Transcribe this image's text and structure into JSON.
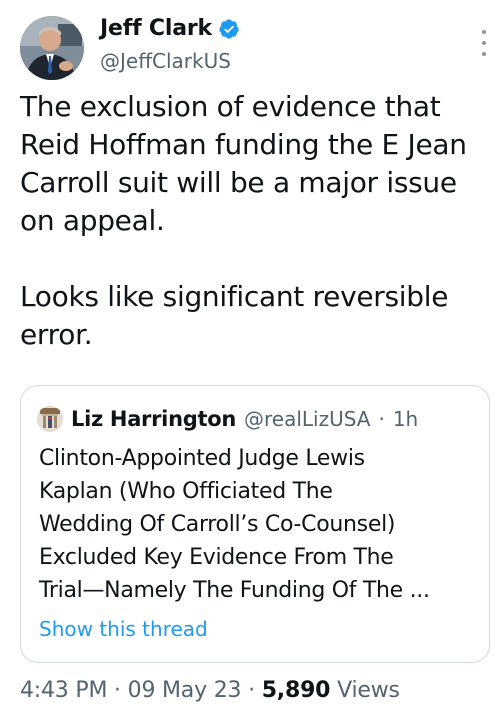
{
  "author": {
    "display_name": "Jeff Clark",
    "handle": "@JeffClarkUS",
    "verified": true,
    "verified_color": "#1d9bf0"
  },
  "tweet": {
    "paragraphs": [
      "The exclusion of evidence that Reid Hoffman funding the E Jean Carroll suit will be a major issue on appeal.",
      "Looks like significant reversible error."
    ]
  },
  "quoted_tweet": {
    "display_name": "Liz Harrington",
    "handle": "@realLizUSA",
    "separator": "·",
    "time_ago": "1h",
    "text_lines": [
      "Clinton-Appointed Judge Lewis",
      "Kaplan (Who Officiated The",
      "Wedding Of Carroll’s Co-Counsel)",
      "Excluded Key Evidence From The",
      "Trial—Namely The Funding Of The ..."
    ],
    "show_thread_label": "Show this thread"
  },
  "meta": {
    "time": "4:43 PM",
    "separator": "·",
    "date": "09 May 23",
    "views_count": "5,890",
    "views_label": "Views"
  },
  "colors": {
    "text": "#0f1419",
    "secondary": "#536471",
    "link": "#1d9bf0",
    "border": "#cfd9de"
  },
  "icons": {
    "more": "more-vertical-icon",
    "verified": "verified-badge-icon"
  }
}
